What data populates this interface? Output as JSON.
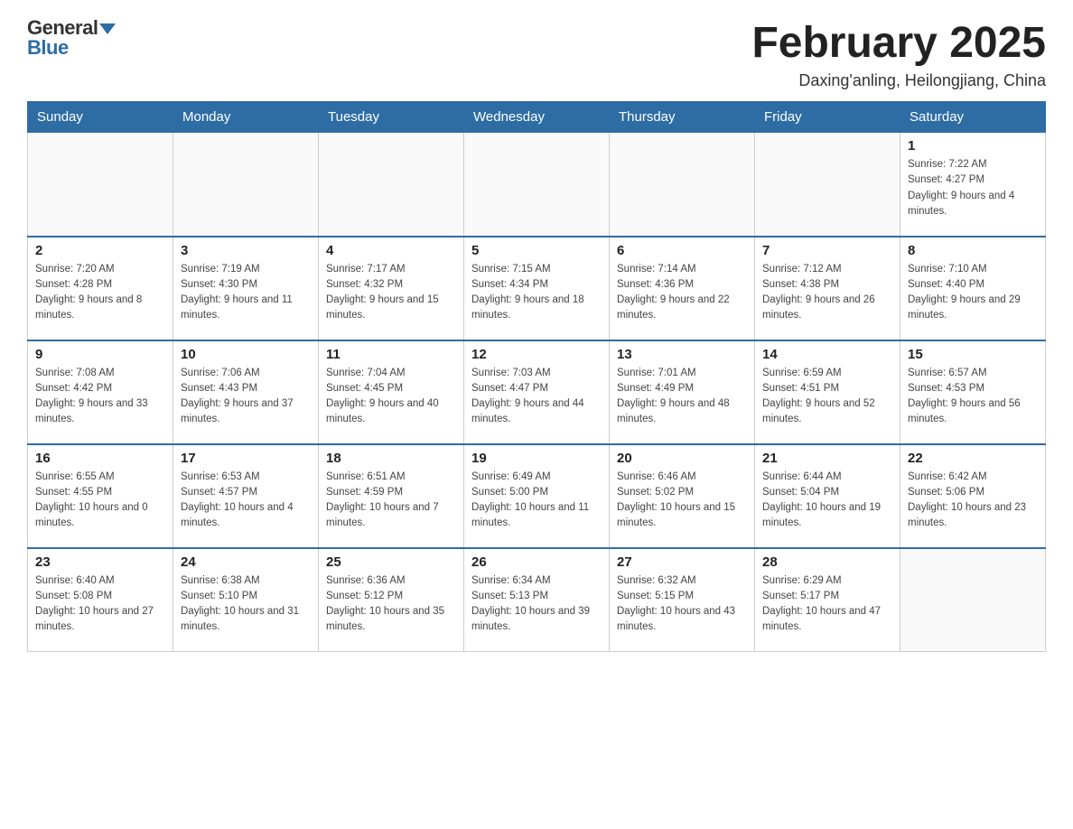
{
  "logo": {
    "general": "General",
    "blue": "Blue"
  },
  "header": {
    "title": "February 2025",
    "subtitle": "Daxing'anling, Heilongjiang, China"
  },
  "weekdays": [
    "Sunday",
    "Monday",
    "Tuesday",
    "Wednesday",
    "Thursday",
    "Friday",
    "Saturday"
  ],
  "weeks": [
    [
      {
        "day": "",
        "info": ""
      },
      {
        "day": "",
        "info": ""
      },
      {
        "day": "",
        "info": ""
      },
      {
        "day": "",
        "info": ""
      },
      {
        "day": "",
        "info": ""
      },
      {
        "day": "",
        "info": ""
      },
      {
        "day": "1",
        "info": "Sunrise: 7:22 AM\nSunset: 4:27 PM\nDaylight: 9 hours and 4 minutes."
      }
    ],
    [
      {
        "day": "2",
        "info": "Sunrise: 7:20 AM\nSunset: 4:28 PM\nDaylight: 9 hours and 8 minutes."
      },
      {
        "day": "3",
        "info": "Sunrise: 7:19 AM\nSunset: 4:30 PM\nDaylight: 9 hours and 11 minutes."
      },
      {
        "day": "4",
        "info": "Sunrise: 7:17 AM\nSunset: 4:32 PM\nDaylight: 9 hours and 15 minutes."
      },
      {
        "day": "5",
        "info": "Sunrise: 7:15 AM\nSunset: 4:34 PM\nDaylight: 9 hours and 18 minutes."
      },
      {
        "day": "6",
        "info": "Sunrise: 7:14 AM\nSunset: 4:36 PM\nDaylight: 9 hours and 22 minutes."
      },
      {
        "day": "7",
        "info": "Sunrise: 7:12 AM\nSunset: 4:38 PM\nDaylight: 9 hours and 26 minutes."
      },
      {
        "day": "8",
        "info": "Sunrise: 7:10 AM\nSunset: 4:40 PM\nDaylight: 9 hours and 29 minutes."
      }
    ],
    [
      {
        "day": "9",
        "info": "Sunrise: 7:08 AM\nSunset: 4:42 PM\nDaylight: 9 hours and 33 minutes."
      },
      {
        "day": "10",
        "info": "Sunrise: 7:06 AM\nSunset: 4:43 PM\nDaylight: 9 hours and 37 minutes."
      },
      {
        "day": "11",
        "info": "Sunrise: 7:04 AM\nSunset: 4:45 PM\nDaylight: 9 hours and 40 minutes."
      },
      {
        "day": "12",
        "info": "Sunrise: 7:03 AM\nSunset: 4:47 PM\nDaylight: 9 hours and 44 minutes."
      },
      {
        "day": "13",
        "info": "Sunrise: 7:01 AM\nSunset: 4:49 PM\nDaylight: 9 hours and 48 minutes."
      },
      {
        "day": "14",
        "info": "Sunrise: 6:59 AM\nSunset: 4:51 PM\nDaylight: 9 hours and 52 minutes."
      },
      {
        "day": "15",
        "info": "Sunrise: 6:57 AM\nSunset: 4:53 PM\nDaylight: 9 hours and 56 minutes."
      }
    ],
    [
      {
        "day": "16",
        "info": "Sunrise: 6:55 AM\nSunset: 4:55 PM\nDaylight: 10 hours and 0 minutes."
      },
      {
        "day": "17",
        "info": "Sunrise: 6:53 AM\nSunset: 4:57 PM\nDaylight: 10 hours and 4 minutes."
      },
      {
        "day": "18",
        "info": "Sunrise: 6:51 AM\nSunset: 4:59 PM\nDaylight: 10 hours and 7 minutes."
      },
      {
        "day": "19",
        "info": "Sunrise: 6:49 AM\nSunset: 5:00 PM\nDaylight: 10 hours and 11 minutes."
      },
      {
        "day": "20",
        "info": "Sunrise: 6:46 AM\nSunset: 5:02 PM\nDaylight: 10 hours and 15 minutes."
      },
      {
        "day": "21",
        "info": "Sunrise: 6:44 AM\nSunset: 5:04 PM\nDaylight: 10 hours and 19 minutes."
      },
      {
        "day": "22",
        "info": "Sunrise: 6:42 AM\nSunset: 5:06 PM\nDaylight: 10 hours and 23 minutes."
      }
    ],
    [
      {
        "day": "23",
        "info": "Sunrise: 6:40 AM\nSunset: 5:08 PM\nDaylight: 10 hours and 27 minutes."
      },
      {
        "day": "24",
        "info": "Sunrise: 6:38 AM\nSunset: 5:10 PM\nDaylight: 10 hours and 31 minutes."
      },
      {
        "day": "25",
        "info": "Sunrise: 6:36 AM\nSunset: 5:12 PM\nDaylight: 10 hours and 35 minutes."
      },
      {
        "day": "26",
        "info": "Sunrise: 6:34 AM\nSunset: 5:13 PM\nDaylight: 10 hours and 39 minutes."
      },
      {
        "day": "27",
        "info": "Sunrise: 6:32 AM\nSunset: 5:15 PM\nDaylight: 10 hours and 43 minutes."
      },
      {
        "day": "28",
        "info": "Sunrise: 6:29 AM\nSunset: 5:17 PM\nDaylight: 10 hours and 47 minutes."
      },
      {
        "day": "",
        "info": ""
      }
    ]
  ]
}
